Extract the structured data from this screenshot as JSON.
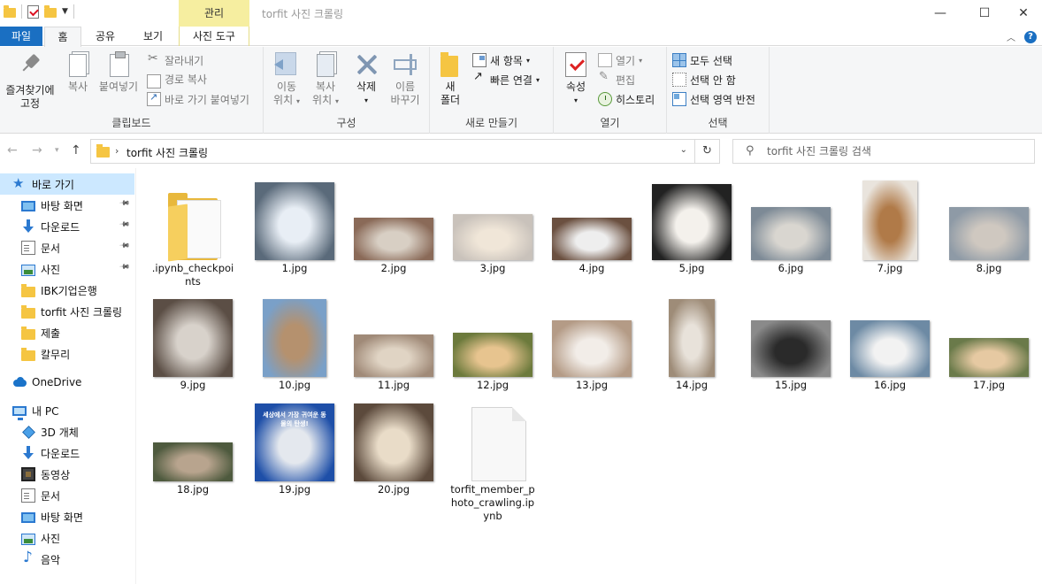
{
  "window": {
    "context_tab_group": "관리",
    "title": "torfit 사진 크롤링",
    "controls": {
      "minimize": "—",
      "maximize": "☐",
      "close": "✕"
    }
  },
  "tabs": {
    "file": "파일",
    "home": "홈",
    "share": "공유",
    "view": "보기",
    "picture_tools": "사진 도구"
  },
  "ribbon": {
    "clipboard": {
      "label": "클립보드",
      "pin": "즐겨찾기에\n고정",
      "pin_line1": "즐겨찾기에",
      "pin_line2": "고정",
      "copy": "복사",
      "paste": "붙여넣기",
      "cut": "잘라내기",
      "copy_path": "경로 복사",
      "paste_shortcut": "바로 가기 붙여넣기"
    },
    "organize": {
      "label": "구성",
      "move_to_1": "이동",
      "move_to_2": "위치",
      "copy_to_1": "복사",
      "copy_to_2": "위치",
      "delete": "삭제",
      "rename_1": "이름",
      "rename_2": "바꾸기"
    },
    "new": {
      "label": "새로 만들기",
      "new_folder_1": "새",
      "new_folder_2": "폴더",
      "new_item": "새 항목",
      "easy_access": "빠른 연결"
    },
    "open": {
      "label": "열기",
      "properties": "속성",
      "open": "열기",
      "edit": "편집",
      "history": "히스토리"
    },
    "select": {
      "label": "선택",
      "select_all": "모두 선택",
      "select_none": "선택 안 함",
      "invert": "선택 영역 반전"
    }
  },
  "address": {
    "path": "torfit 사진 크롤링",
    "search_placeholder": "torfit 사진 크롤링 검색"
  },
  "sidebar": {
    "items": [
      {
        "label": "바로 가기",
        "icon": "star-icon",
        "selected": true
      },
      {
        "label": "바탕 화면",
        "icon": "desktop-icon",
        "pinned": true
      },
      {
        "label": "다운로드",
        "icon": "download-icon",
        "pinned": true
      },
      {
        "label": "문서",
        "icon": "document-icon",
        "pinned": true
      },
      {
        "label": "사진",
        "icon": "pictures-icon",
        "pinned": true
      },
      {
        "label": "IBK기업은행",
        "icon": "folder-icon"
      },
      {
        "label": "torfit 사진 크롤링",
        "icon": "folder-icon"
      },
      {
        "label": "제출",
        "icon": "folder-icon"
      },
      {
        "label": "칼무리",
        "icon": "folder-icon"
      },
      {
        "label": "OneDrive",
        "icon": "cloud-icon"
      },
      {
        "label": "내 PC",
        "icon": "pc-icon"
      },
      {
        "label": "3D 개체",
        "icon": "3d-objects-icon"
      },
      {
        "label": "다운로드",
        "icon": "download-icon"
      },
      {
        "label": "동영상",
        "icon": "video-icon"
      },
      {
        "label": "문서",
        "icon": "document-icon"
      },
      {
        "label": "바탕 화면",
        "icon": "desktop-icon"
      },
      {
        "label": "사진",
        "icon": "pictures-icon"
      },
      {
        "label": "음악",
        "icon": "music-icon"
      }
    ]
  },
  "files": [
    {
      "name": ".ipynb_checkpoints",
      "type": "folder"
    },
    {
      "name": "1.jpg",
      "type": "image",
      "colors": [
        "#5a6a7a",
        "#e8eef5"
      ]
    },
    {
      "name": "2.jpg",
      "type": "image",
      "colors": [
        "#8a6a58",
        "#d8cfc4"
      ]
    },
    {
      "name": "3.jpg",
      "type": "image",
      "colors": [
        "#c9c2bb",
        "#f0e6d8"
      ]
    },
    {
      "name": "4.jpg",
      "type": "image",
      "colors": [
        "#6b5040",
        "#eeeeee"
      ]
    },
    {
      "name": "5.jpg",
      "type": "image",
      "colors": [
        "#222222",
        "#f4f1ec"
      ]
    },
    {
      "name": "6.jpg",
      "type": "image",
      "colors": [
        "#7d8a96",
        "#d9d6d0"
      ]
    },
    {
      "name": "7.jpg",
      "type": "image",
      "colors": [
        "#e9e4dd",
        "#b07a48"
      ]
    },
    {
      "name": "8.jpg",
      "type": "image",
      "colors": [
        "#8e9aa6",
        "#cfc8c0"
      ]
    },
    {
      "name": "9.jpg",
      "type": "image",
      "colors": [
        "#5b4e45",
        "#d8d2cb"
      ]
    },
    {
      "name": "10.jpg",
      "type": "image",
      "colors": [
        "#7aa0c8",
        "#b5916e"
      ]
    },
    {
      "name": "11.jpg",
      "type": "image",
      "colors": [
        "#a08a78",
        "#e0d4c4"
      ]
    },
    {
      "name": "12.jpg",
      "type": "image",
      "colors": [
        "#6c7a3c",
        "#e7c48f"
      ]
    },
    {
      "name": "13.jpg",
      "type": "image",
      "colors": [
        "#b49b86",
        "#f2ede8"
      ]
    },
    {
      "name": "14.jpg",
      "type": "image",
      "colors": [
        "#9e8c78",
        "#e8e2da"
      ]
    },
    {
      "name": "15.jpg",
      "type": "image",
      "colors": [
        "#8a8a8a",
        "#2a2a2a"
      ]
    },
    {
      "name": "16.jpg",
      "type": "image",
      "colors": [
        "#6d8aa4",
        "#f2f2f2"
      ]
    },
    {
      "name": "17.jpg",
      "type": "image",
      "colors": [
        "#6a7a4a",
        "#e6c9a2"
      ]
    },
    {
      "name": "18.jpg",
      "type": "image",
      "colors": [
        "#4e5a3e",
        "#b8a48e"
      ]
    },
    {
      "name": "19.jpg",
      "type": "image",
      "colors": [
        "#1e4fa8",
        "#e4e8ee"
      ],
      "overlay_text": "세상에서 가장 귀여운 동물의 탄생!"
    },
    {
      "name": "20.jpg",
      "type": "image",
      "colors": [
        "#5c4a3c",
        "#e9dcc8"
      ]
    },
    {
      "name": "torfit_member_photo_crawling.ipynb",
      "type": "file"
    }
  ]
}
